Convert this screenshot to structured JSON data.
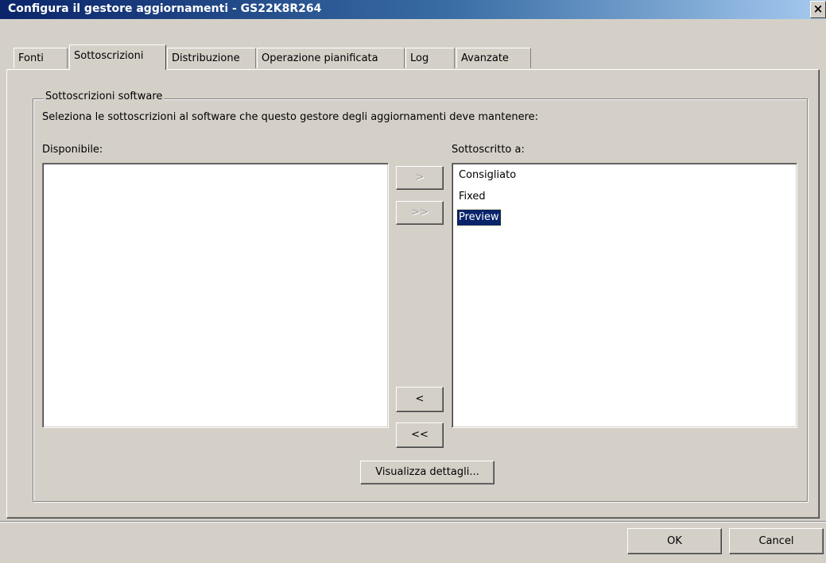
{
  "window": {
    "title": "Configura il gestore aggiornamenti - GS22K8R264",
    "close_glyph": "×"
  },
  "tabs": [
    {
      "label": "Fonti"
    },
    {
      "label": "Sottoscrizioni",
      "active": true
    },
    {
      "label": "Distribuzione"
    },
    {
      "label": "Operazione pianificata"
    },
    {
      "label": "Log"
    },
    {
      "label": "Avanzate"
    }
  ],
  "group": {
    "title": "Sottoscrizioni software",
    "description": "Seleziona le sottoscrizioni al software che questo gestore degli aggiornamenti deve mantenere:"
  },
  "available": {
    "label": "Disponibile:",
    "items": []
  },
  "subscribed": {
    "label": "Sottoscritto a:",
    "items": [
      {
        "label": "Consigliato",
        "selected": false
      },
      {
        "label": "Fixed",
        "selected": false
      },
      {
        "label": "Preview",
        "selected": true
      }
    ]
  },
  "transfer_buttons": {
    "add": ">",
    "add_all": ">>",
    "remove": "<",
    "remove_all": "<<"
  },
  "details_button": "Visualizza dettagli...",
  "footer": {
    "ok": "OK",
    "cancel": "Cancel"
  }
}
